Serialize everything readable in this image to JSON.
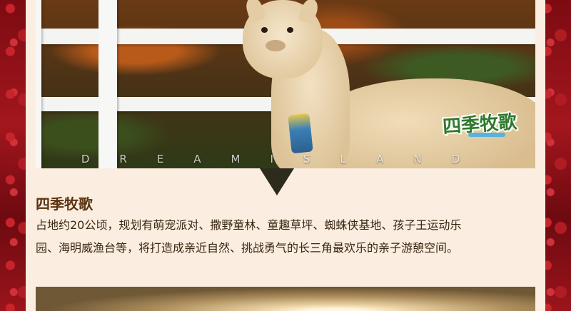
{
  "photo": {
    "watermark": "DREAMISLAND",
    "logo_text": "四季牧歌"
  },
  "section": {
    "title": "四季牧歌",
    "description_line1": "占地约20公顷，规划有萌宠派对、撒野童林、童趣草坪、蜘蛛侠基地、孩子王运动乐",
    "description_line2": "园、海明威渔台等，将打造成亲近自然、挑战勇气的长三角最欢乐的亲子游憩空间。"
  },
  "colors": {
    "background_red": "#8a0f15",
    "card": "#fbeee0",
    "title": "#5a3412",
    "text": "#3a2612",
    "logo_green": "#2f7a2c"
  }
}
